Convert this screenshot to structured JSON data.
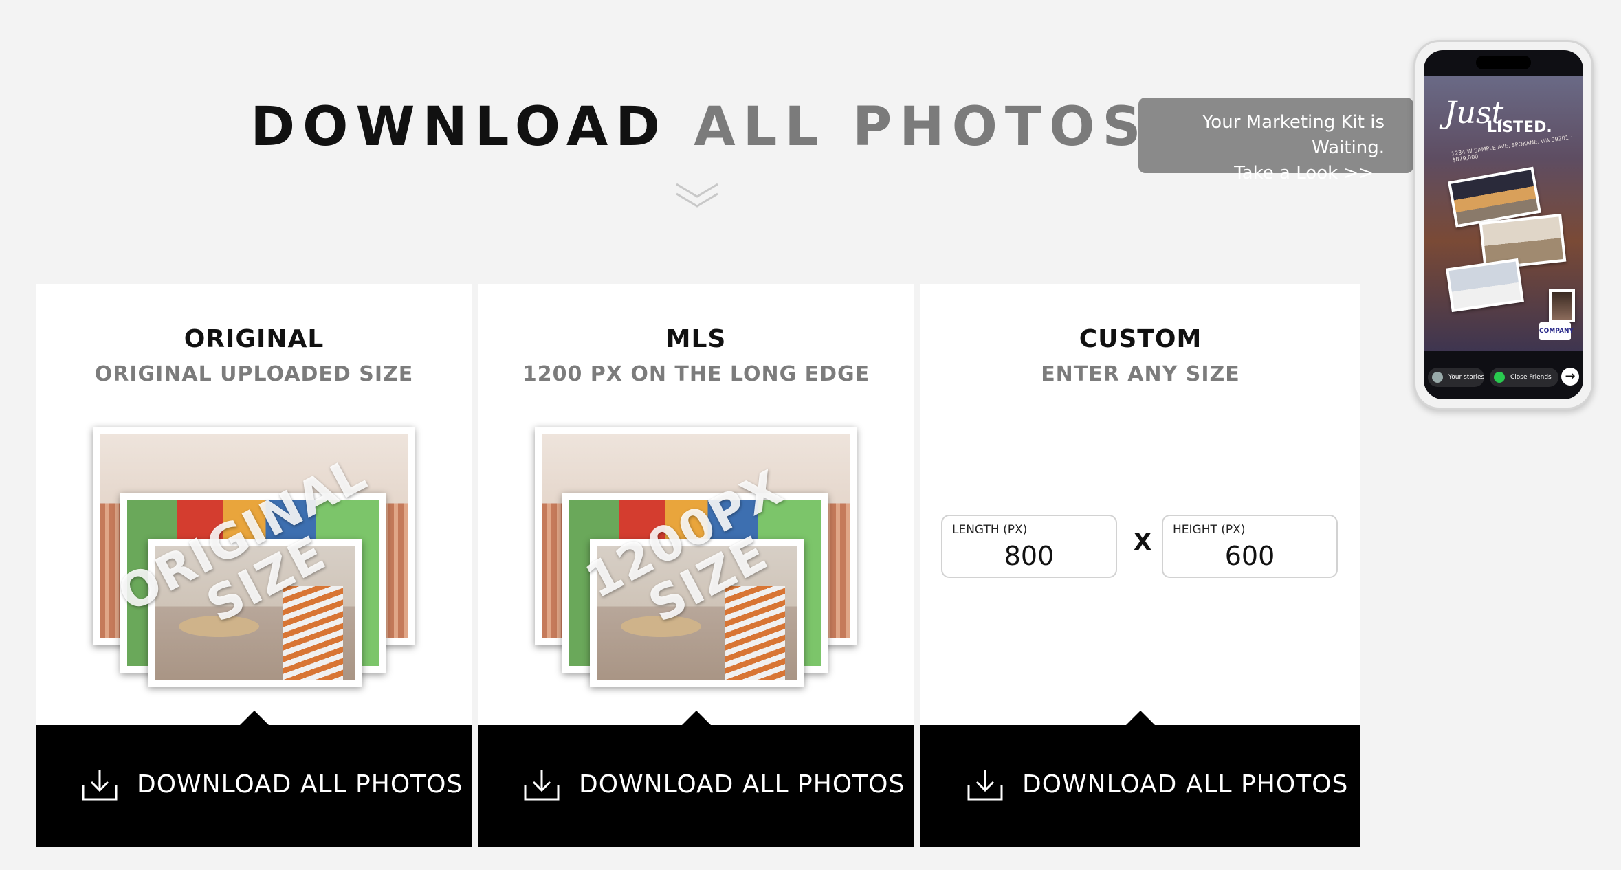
{
  "header": {
    "title_dark": "DOWNLOAD",
    "title_light": "ALL PHOTOS",
    "chevron_icon": "double-chevron-down-icon"
  },
  "promo": {
    "line1": "Your Marketing Kit is Waiting.",
    "line2": "Take a Look >>"
  },
  "cards": [
    {
      "title": "ORIGINAL",
      "subtitle": "ORIGINAL UPLOADED SIZE",
      "overlay_line1": "ORIGINAL",
      "overlay_line2": "SIZE",
      "button_label": "DOWNLOAD ALL PHOTOS"
    },
    {
      "title": "MLS",
      "subtitle": "1200 PX ON THE LONG EDGE",
      "overlay_line1": "1200PX",
      "overlay_line2": "SIZE",
      "button_label": "DOWNLOAD ALL PHOTOS"
    },
    {
      "title": "CUSTOM",
      "subtitle": "ENTER ANY SIZE",
      "length_label": "LENGTH (PX)",
      "length_value": "800",
      "separator": "X",
      "height_label": "HEIGHT (PX)",
      "height_value": "600",
      "button_label": "DOWNLOAD ALL PHOTOS"
    }
  ],
  "phone": {
    "story_script": "Just",
    "story_title": "LISTED.",
    "story_address": "1234 W SAMPLE AVE, SPOKANE, WA 99201 · $879,000",
    "logo_text": "COMPANY",
    "pill1_label": "Your stories",
    "pill2_label": "Close Friends",
    "send_icon": "arrow-right-icon"
  },
  "colors": {
    "background": "#f3f3f3",
    "button_bg": "#000000",
    "promo_bg": "#8a8a8a",
    "subtitle": "#7c7c7c"
  }
}
